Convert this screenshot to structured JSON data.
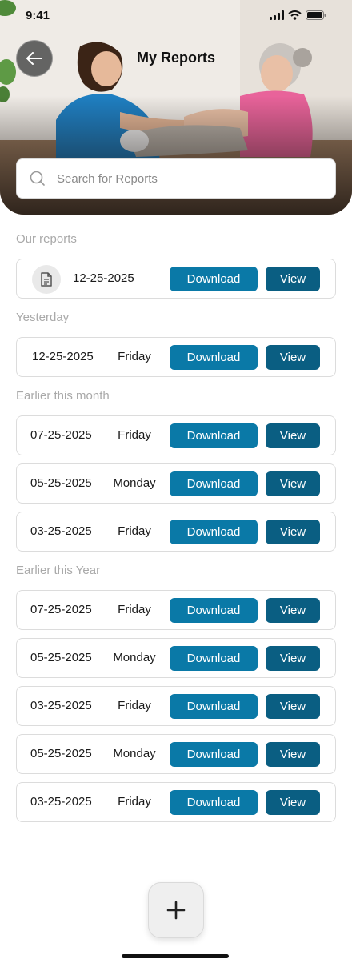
{
  "status_bar": {
    "time": "9:41"
  },
  "header": {
    "title": "My Reports",
    "back_icon": "arrow-left-icon",
    "hero_image": "therapist-helping-senior-woman-exercise"
  },
  "search": {
    "placeholder": "Search for Reports",
    "value": "",
    "icon": "search-icon"
  },
  "sections": [
    {
      "title": "Our reports",
      "rows": [
        {
          "date": "12-25-2025",
          "day": "",
          "icon": "document-icon"
        }
      ]
    },
    {
      "title": "Yesterday",
      "rows": [
        {
          "date": "12-25-2025",
          "day": "Friday"
        }
      ]
    },
    {
      "title": "Earlier this month",
      "rows": [
        {
          "date": "07-25-2025",
          "day": "Friday"
        },
        {
          "date": "05-25-2025",
          "day": "Monday"
        },
        {
          "date": "03-25-2025",
          "day": "Friday"
        }
      ]
    },
    {
      "title": "Earlier this Year",
      "rows": [
        {
          "date": "07-25-2025",
          "day": "Friday"
        },
        {
          "date": "05-25-2025",
          "day": "Monday"
        },
        {
          "date": "03-25-2025",
          "day": "Friday"
        },
        {
          "date": "05-25-2025",
          "day": "Monday"
        },
        {
          "date": "03-25-2025",
          "day": "Friday"
        }
      ]
    }
  ],
  "actions": {
    "download_label": "Download",
    "view_label": "View"
  },
  "fab": {
    "icon": "plus-icon"
  },
  "colors": {
    "download_button": "#0a79a7",
    "view_button": "#0a5e82",
    "section_title": "#a9a9a9",
    "card_border": "#dcdcdc"
  }
}
